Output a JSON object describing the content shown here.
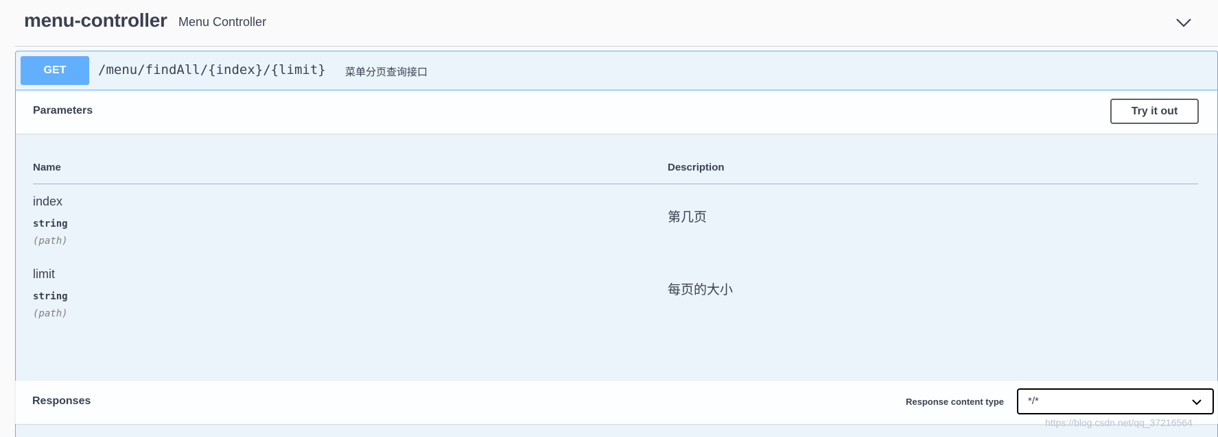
{
  "tag": {
    "name": "menu-controller",
    "description": "Menu Controller"
  },
  "operation": {
    "method": "GET",
    "path": "/menu/findAll/{index}/{limit}",
    "summary": "菜单分页查询接口",
    "method_color": "#61affe"
  },
  "parameters": {
    "section_title": "Parameters",
    "try_button": "Try it out",
    "columns": {
      "name": "Name",
      "description": "Description"
    },
    "items": [
      {
        "name": "index",
        "type": "string",
        "in": "(path)",
        "description": "第几页"
      },
      {
        "name": "limit",
        "type": "string",
        "in": "(path)",
        "description": "每页的大小"
      }
    ]
  },
  "responses": {
    "section_title": "Responses",
    "content_type_label": "Response content type",
    "content_type_value": "*/*"
  },
  "watermark": "https://blog.csdn.net/qq_37216564"
}
